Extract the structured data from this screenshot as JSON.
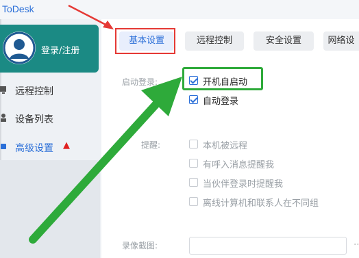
{
  "app": {
    "title": "ToDesk"
  },
  "sidebar": {
    "login_label": "登录/注册",
    "items": [
      {
        "label": "远程控制",
        "icon": "monitor-icon"
      },
      {
        "label": "设备列表",
        "icon": "devices-icon"
      },
      {
        "label": "高级设置",
        "icon": "settings-icon",
        "active": true
      }
    ]
  },
  "tabs": [
    {
      "label": "基本设置",
      "active": true
    },
    {
      "label": "远程控制"
    },
    {
      "label": "安全设置"
    },
    {
      "label": "网络设"
    }
  ],
  "startup": {
    "label": "启动登录:",
    "options": [
      {
        "label": "开机自启动",
        "checked": true
      },
      {
        "label": "自动登录",
        "checked": true
      }
    ]
  },
  "notify": {
    "label": "提醒:",
    "options": [
      {
        "label": "本机被远程",
        "checked": false
      },
      {
        "label": "有呼入消息提醒我",
        "checked": false
      },
      {
        "label": "当伙伴登录时提醒我",
        "checked": false
      },
      {
        "label": "离线计算机和联系人在不同组",
        "checked": false
      }
    ]
  },
  "recording": {
    "label": "录像截图:",
    "value": ""
  },
  "colors": {
    "accent": "#2b6fd8",
    "brand": "#1b8a84",
    "highlight_red": "#e53935",
    "highlight_green": "#2eaa3a"
  }
}
